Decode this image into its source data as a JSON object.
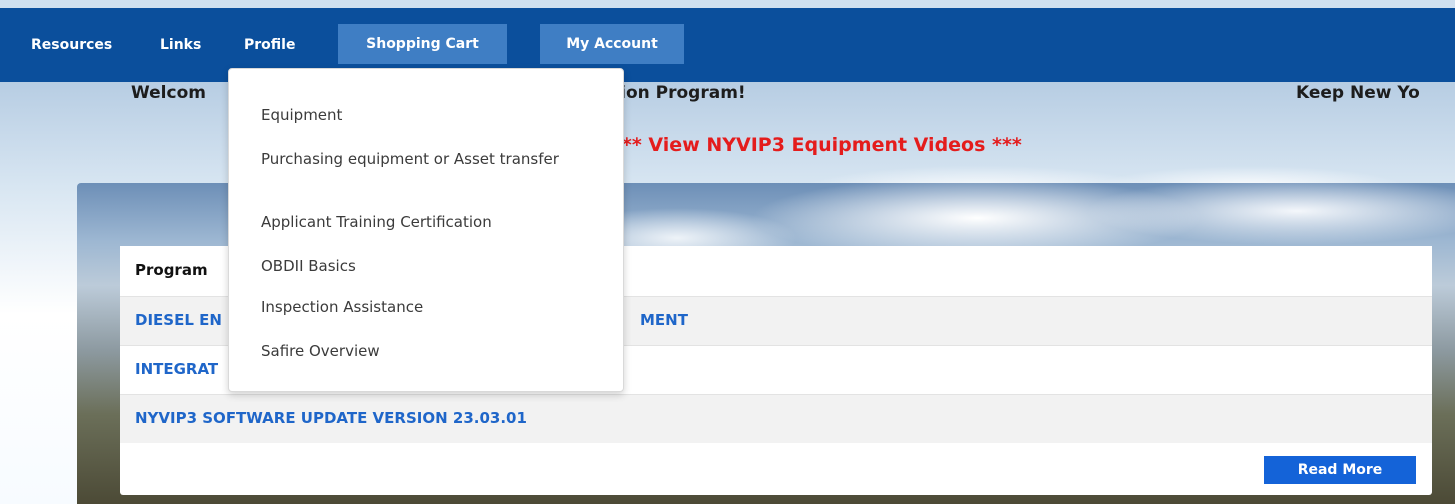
{
  "nav": {
    "resources": "Resources",
    "links": "Links",
    "profile": "Profile",
    "shopping_cart": "Shopping Cart",
    "my_account": "My Account"
  },
  "banner": {
    "welcome_left": "Welcom",
    "welcome_right": "tion Program!",
    "keep_text": "Keep New Yo",
    "videos_link": "*** View NYVIP3 Equipment Videos ***"
  },
  "dropdown": {
    "items": [
      "Equipment",
      "Purchasing equipment or Asset transfer",
      "Applicant Training Certification",
      "OBDII Basics",
      "Inspection Assistance",
      "Safire Overview"
    ]
  },
  "program_panel": {
    "header": "Program",
    "rows": [
      {
        "left": "DIESEL EN",
        "right": "MENT"
      },
      {
        "left": "INTEGRAT",
        "right": ""
      },
      {
        "left": "NYVIP3 SOFTWARE UPDATE VERSION 23.03.01",
        "right": ""
      }
    ],
    "read_more": "Read More"
  }
}
